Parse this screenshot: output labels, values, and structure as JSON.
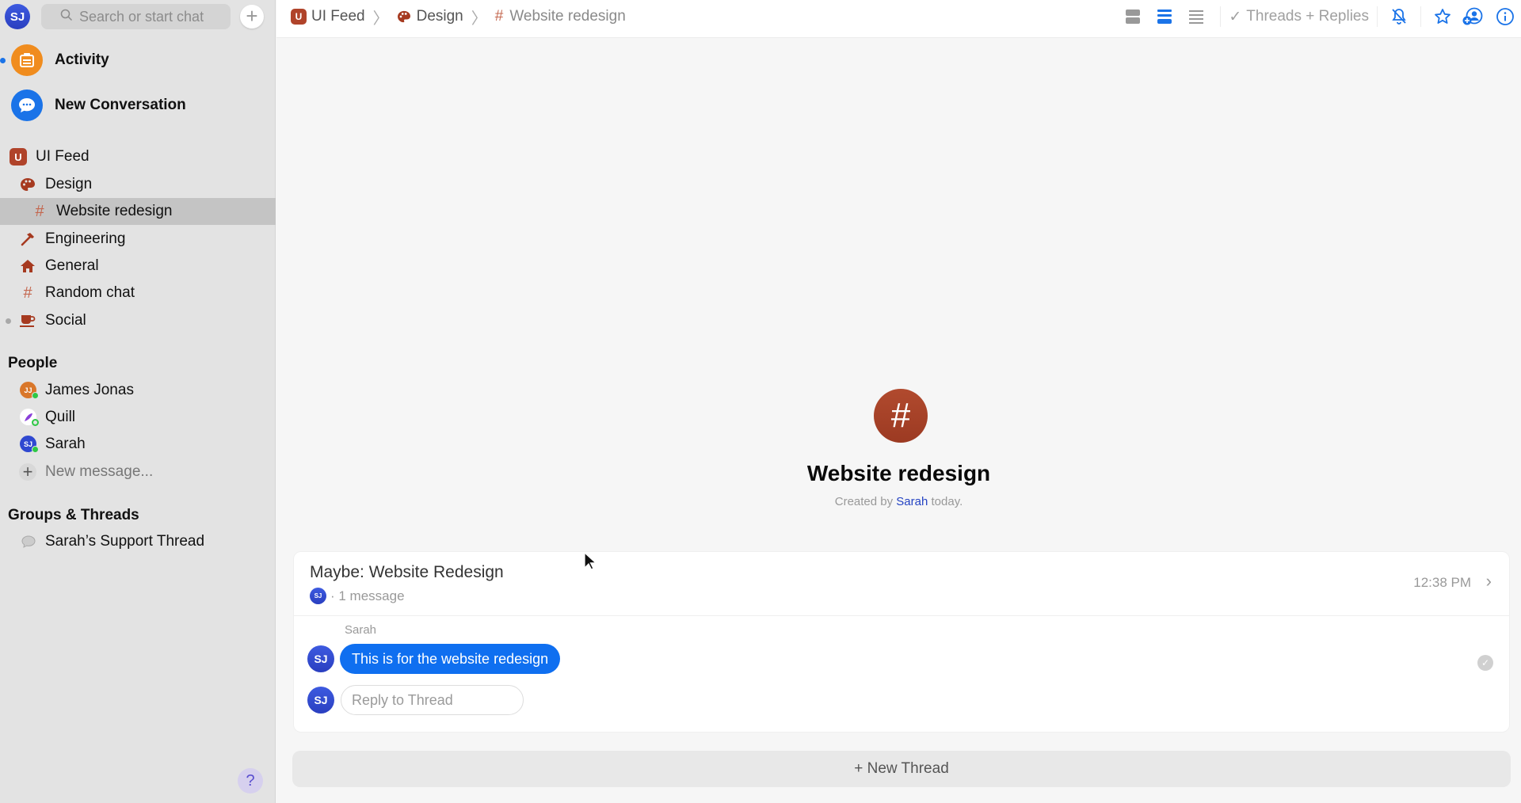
{
  "sidebar": {
    "user_initials": "SJ",
    "search_placeholder": "Search or start chat",
    "new_button": "+",
    "activity_label": "Activity",
    "new_conversation_label": "New Conversation",
    "workspace": {
      "initial": "U",
      "name": "UI Feed"
    },
    "channels": [
      {
        "label": "Design",
        "icon": "palette-icon"
      },
      {
        "label": "Website redesign",
        "icon": "hash-icon",
        "selected": true
      },
      {
        "label": "Engineering",
        "icon": "hammer-icon"
      },
      {
        "label": "General",
        "icon": "house-icon"
      },
      {
        "label": "Random chat",
        "icon": "hash-icon"
      },
      {
        "label": "Social",
        "icon": "cup-icon",
        "unread": true
      }
    ],
    "people_header": "People",
    "people": [
      {
        "name": "James Jonas",
        "initials": "JJ",
        "color": "#d9772a",
        "status": "online"
      },
      {
        "name": "Quill",
        "initials": "",
        "color": "#ffffff",
        "status": "away"
      },
      {
        "name": "Sarah",
        "initials": "SJ",
        "color": "#2f48d0",
        "status": "online"
      }
    ],
    "new_message_label": "New message...",
    "groups_header": "Groups & Threads",
    "groups": [
      {
        "label": "Sarah’s Support Thread",
        "icon": "speech-bubble-icon"
      }
    ],
    "help_label": "?"
  },
  "header": {
    "breadcrumb": [
      {
        "label": "UI Feed",
        "icon": "workspace-icon",
        "initial": "U"
      },
      {
        "label": "Design",
        "icon": "palette-icon"
      },
      {
        "label": "Website redesign",
        "icon": "hash-icon"
      }
    ],
    "filter_label": "Threads + Replies",
    "layout_modes": [
      "cards",
      "compact",
      "list"
    ],
    "active_layout": "compact"
  },
  "channel": {
    "icon_glyph": "#",
    "title": "Website redesign",
    "created_prefix": "Created by",
    "created_by": "Sarah",
    "created_suffix": "today."
  },
  "thread": {
    "title": "Maybe: Website Redesign",
    "participant_initials": "SJ",
    "message_count": "· 1 message",
    "time": "12:38 PM",
    "messages": [
      {
        "sender": "Sarah",
        "initials": "SJ",
        "text": "This is for the website redesign"
      }
    ],
    "reply_placeholder": "Reply to Thread",
    "reply_initials": "SJ"
  },
  "new_thread_label": "+ New Thread",
  "colors": {
    "accent": "#0f6ff0",
    "channel": "#a63a20",
    "sidebar_bg": "#e3e3e3"
  }
}
